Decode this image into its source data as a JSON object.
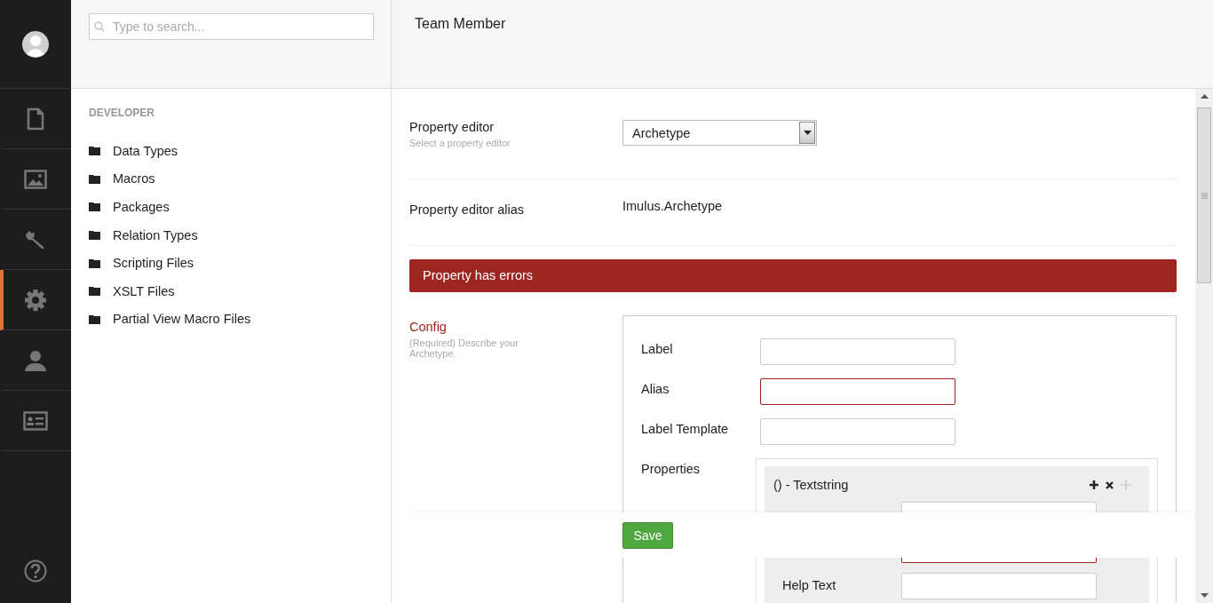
{
  "nav": {
    "items": [
      {
        "kind": "document",
        "selected": false
      },
      {
        "kind": "image",
        "selected": false
      },
      {
        "kind": "wrench",
        "selected": false
      },
      {
        "kind": "gear",
        "selected": true
      },
      {
        "kind": "user",
        "selected": false
      },
      {
        "kind": "card",
        "selected": false
      }
    ]
  },
  "tree": {
    "search": {
      "placeholder": "Type to search..."
    },
    "section": "DEVELOPER",
    "items": [
      "Data Types",
      "Macros",
      "Packages",
      "Relation Types",
      "Scripting Files",
      "XSLT Files",
      "Partial View Macro Files"
    ]
  },
  "editor": {
    "title": "Team Member",
    "property_editor": {
      "label": "Property editor",
      "hint": "Select a property editor",
      "value": "Archetype"
    },
    "alias": {
      "label": "Property editor alias",
      "value": "Imulus.Archetype"
    },
    "error_banner": "Property has errors",
    "config": {
      "label": "Config",
      "hint": "(Required) Describe your Archetype.",
      "error": true,
      "fields": [
        {
          "label": "Label",
          "error": false
        },
        {
          "label": "Alias",
          "error": true
        },
        {
          "label": "Label Template",
          "error": false
        }
      ],
      "properties": {
        "label": "Properties",
        "item": {
          "title": "() - Textstring",
          "fields": [
            {
              "error": false
            },
            {
              "error": true
            },
            {
              "label": "Help Text",
              "error": false
            }
          ]
        }
      }
    },
    "save": "Save"
  }
}
